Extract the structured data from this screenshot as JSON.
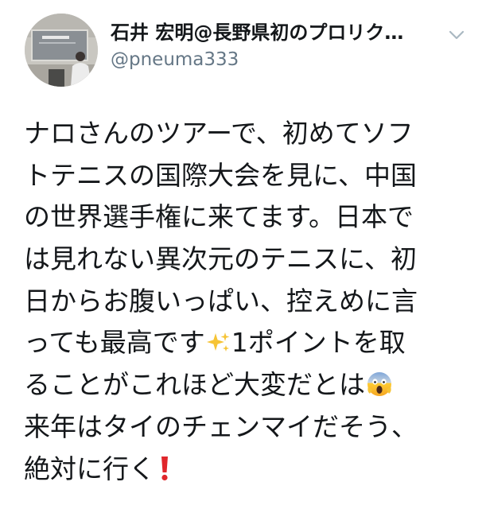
{
  "tweet": {
    "author": {
      "display_name": "石井 宏明@長野県初のプロリク…",
      "handle": "@pneuma333",
      "avatar_icon": "profile-photo-presentation"
    },
    "menu_icon": "chevron-down-icon",
    "text_lines": [
      "ナロさんのツアーで、初めてソフ",
      "トテニスの国際大会を見に、中国",
      "の世界選手権に来てます。日本で",
      "は見れない異次元のテニスに、初",
      "日からお腹いっぱい、控えめに言",
      "っても最高です",
      "1ポイントを取",
      "ることがこれほど大変だとは",
      "来年はタイのチェンマイだそう、",
      "絶対に行く"
    ],
    "emojis": {
      "sparkles": "sparkles-emoji",
      "scream": "face-screaming-in-fear-emoji",
      "exclamation": "red-exclamation-mark-emoji"
    },
    "colors": {
      "text": "#14171a",
      "handle": "#657786",
      "caret": "#aab8c2",
      "exclamation": "#e0262b",
      "sparkles": "#f6c436"
    }
  }
}
